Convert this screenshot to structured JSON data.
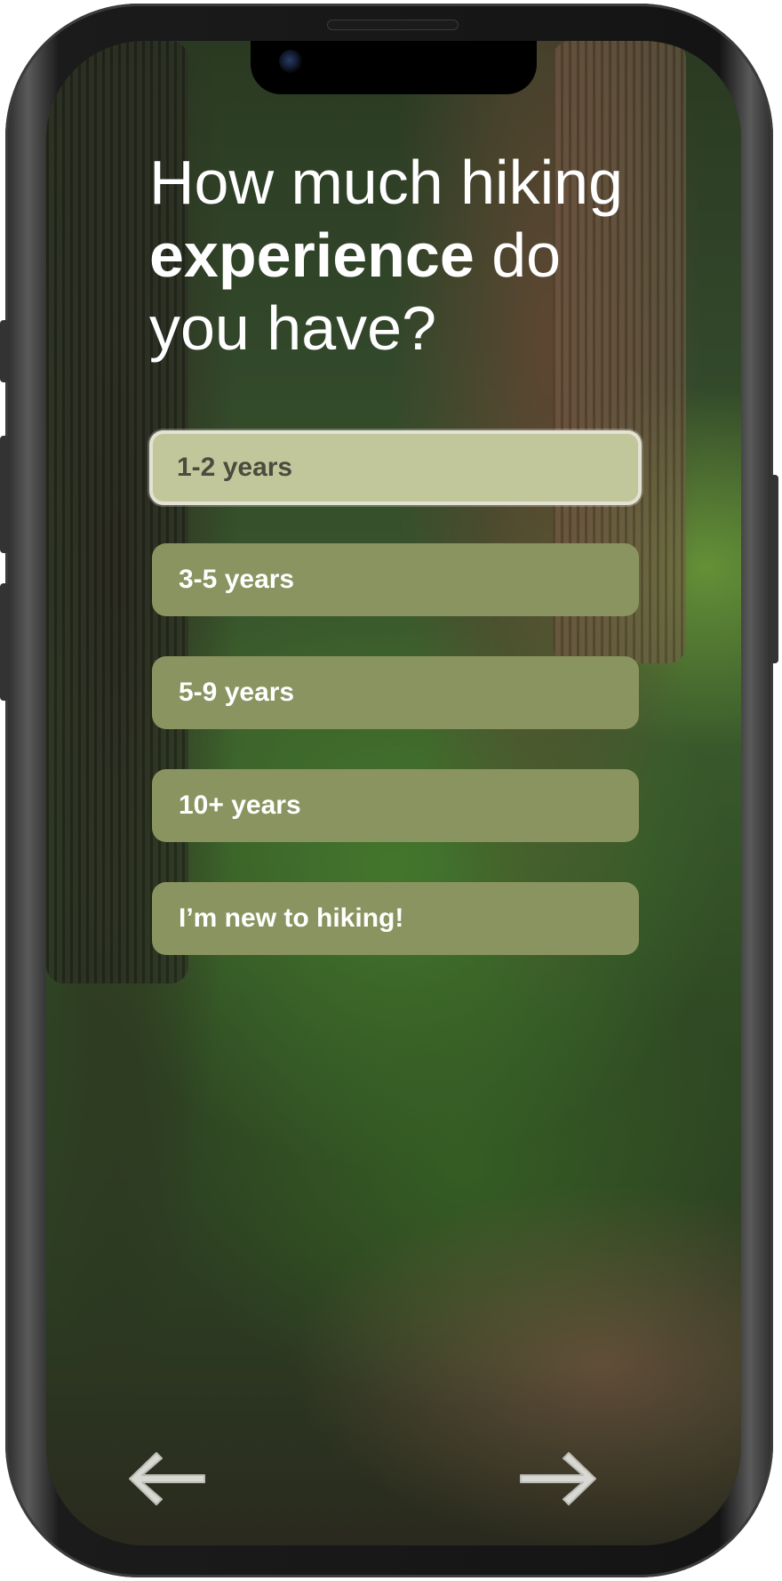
{
  "question": {
    "line1": "How much hiking",
    "bold_word": "experience",
    "after_bold": " do",
    "line3": "you have?"
  },
  "options": [
    {
      "label": "1-2 years",
      "selected": true
    },
    {
      "label": "3-5 years",
      "selected": false
    },
    {
      "label": "5-9 years",
      "selected": false
    },
    {
      "label": "10+ years",
      "selected": false
    },
    {
      "label": "I’m new to hiking!",
      "selected": false
    }
  ],
  "navigation": {
    "back_icon": "arrow-left-icon",
    "next_icon": "arrow-right-icon"
  },
  "colors": {
    "option_bg": "#8a9460",
    "option_selected_bg": "#c1c79a",
    "option_selected_text": "#4b4b3f",
    "heading_text": "#ffffff"
  }
}
